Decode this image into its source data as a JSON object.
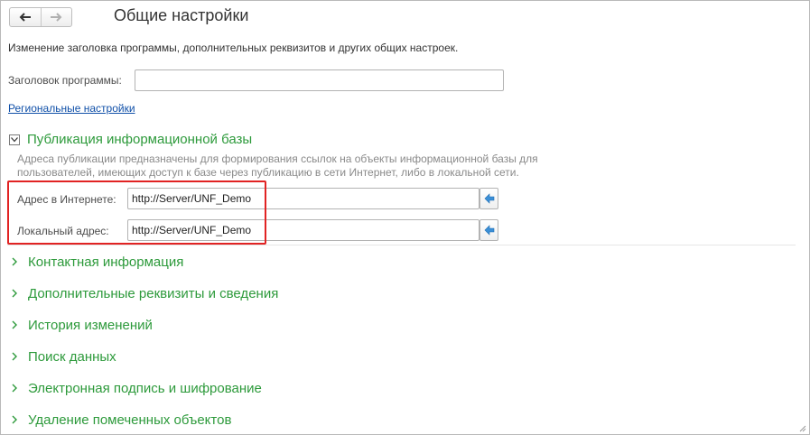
{
  "window": {
    "title": "Общие настройки",
    "description": "Изменение заголовка программы, дополнительных реквизитов и других общих настроек."
  },
  "nav": {
    "back_icon": "arrow-left-icon",
    "forward_icon": "arrow-right-icon"
  },
  "program_title": {
    "label": "Заголовок программы:",
    "value": ""
  },
  "regional_link": "Региональные настройки",
  "publication": {
    "title": "Публикация информационной базы",
    "expanded": true,
    "description": "Адреса публикации предназначены для формирования ссылок на объекты информационной базы для пользователей, имеющих доступ к базе через публикацию в сети Интернет, либо в локальной сети.",
    "internet_label": "Адрес в Интернете:",
    "internet_value": "http://Server/UNF_Demo",
    "local_label": "Локальный адрес:",
    "local_value": "http://Server/UNF_Demo",
    "go_icon": "arrow-left-blue-icon"
  },
  "groups": [
    {
      "title": "Контактная информация"
    },
    {
      "title": "Дополнительные реквизиты и сведения"
    },
    {
      "title": "История изменений"
    },
    {
      "title": "Поиск данных"
    },
    {
      "title": "Электронная подпись и шифрование"
    },
    {
      "title": "Удаление помеченных объектов"
    }
  ],
  "colors": {
    "group_title": "#2d9a3b",
    "link": "#0f4fa8",
    "highlight": "#e12323",
    "go_arrow": "#3b8fd6"
  }
}
